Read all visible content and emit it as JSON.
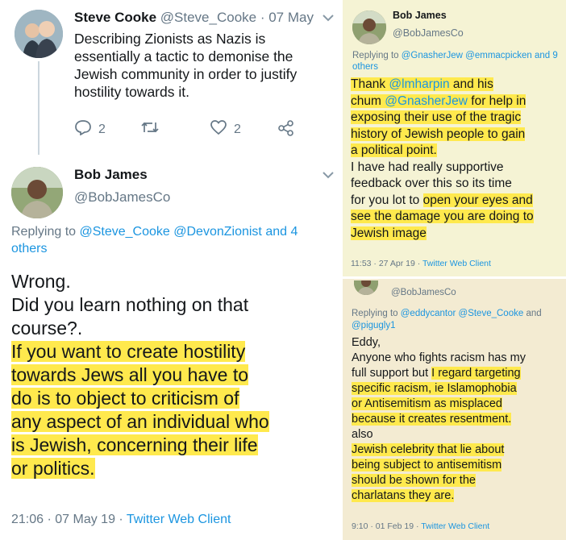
{
  "steve_tweet": {
    "name": "Steve Cooke",
    "handle": "@Steve_Cooke",
    "date": "· 07 May",
    "text_lines": [
      "Describing Zionists as Nazis is",
      "essentially a tactic to demonise the",
      "Jewish community in order to justify",
      "hostility towards it."
    ],
    "reply_count": "2",
    "like_count": "2",
    "icons": [
      "reply-icon",
      "retweet-icon",
      "like-icon",
      "share-icon",
      "chevron-down-icon"
    ]
  },
  "bob_tweet": {
    "name": "Bob James",
    "handle": "@BobJamesCo",
    "replying_prefix": "Replying to",
    "replying_handles": "@Steve_Cooke @DevonZionist",
    "replying_suffix": "and 4 others",
    "text_plain": [
      "Wrong.",
      "Did you learn nothing on that",
      "course?."
    ],
    "text_highlighted": [
      "If you want to create hostility",
      "towards Jews all you have to",
      "do is to object to criticism of",
      "any aspect of an individual who",
      "is Jewish, concerning their life",
      "or politics."
    ],
    "timestamp": "21:06 · 07 May 19 ·",
    "client": "Twitter Web Client"
  },
  "panel_top_right": {
    "name": "Bob James",
    "handle": "@BobJamesCo",
    "replying_prefix": "Replying to",
    "replying_handles": "@GnasherJew @emmacpicken",
    "replying_suffix": "and 9 others",
    "line1_a": "Thank ",
    "line1_mention": "@lmharpin",
    "line1_b": " and his",
    "line2_a": "chum ",
    "line2_mention": "@GnasherJew",
    "line2_b": " for help in",
    "line3": "exposing their use of the tragic",
    "line4": "history of Jewish people to gain",
    "line5": "a political point.",
    "line6": "I have had really supportive",
    "line7": "feedback over this so its time",
    "line8_a": "for you lot to ",
    "line8_b": "open your eyes and",
    "line9": "see the damage you are doing to",
    "line10": "Jewish image",
    "timestamp": "11:53 · 27 Apr 19 ·",
    "client": "Twitter Web Client"
  },
  "panel_bottom_right": {
    "handle": "@BobJamesCo",
    "replying_prefix": "Replying to",
    "replying_handles": "@eddycantor @Steve_Cooke",
    "replying_mid": "and",
    "replying_last": "@pigugly1",
    "line1": "Eddy,",
    "line2": "Anyone who fights racism has my",
    "line3_a": "full support but ",
    "line3_b": "I regard targeting",
    "line4": "specific racism, ie Islamophobia",
    "line5": "or Antisemitism as misplaced",
    "line6": "because it creates resentment.",
    "line7": "also",
    "line8": "Jewish celebrity that lie about",
    "line9": "being subject to antisemitism",
    "line10": "should be shown for the",
    "line11": "charlatans they are.",
    "timestamp": "9:10 · 01 Feb 19 ·",
    "client": "Twitter Web Client"
  }
}
